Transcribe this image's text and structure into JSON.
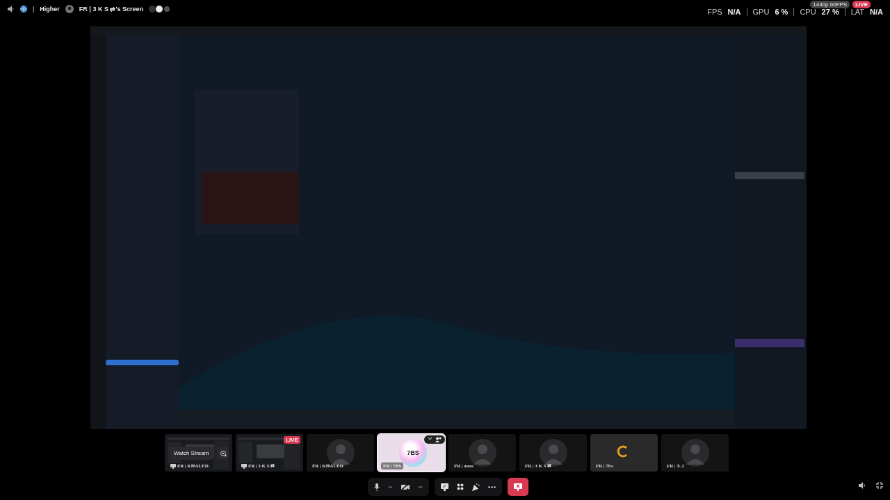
{
  "header": {
    "server": "Higher",
    "separator": "|",
    "stream_title": "FR | 3 K S ⇄'s Screen"
  },
  "stats": [
    {
      "label": "FPS",
      "value": "N/A"
    },
    {
      "label": "GPU",
      "value": "6 %"
    },
    {
      "label": "CPU",
      "value": "27 %"
    },
    {
      "label": "LAT",
      "value": "N/A"
    }
  ],
  "stream_badge": {
    "quality": "1440p 60FPS",
    "live": "LIVE"
  },
  "tiles": [
    {
      "kind": "stream",
      "name": "FR | KĦALED",
      "action": "Watch Stream",
      "selected": false
    },
    {
      "kind": "stream",
      "name": "FR | 3 K S ⇄",
      "live": "LIVE",
      "selected": false
    },
    {
      "kind": "avatar",
      "name": "FR | KĦALED",
      "selected": false
    },
    {
      "kind": "orb",
      "name": "FR | 7BS",
      "text": "7BS",
      "selected": true
    },
    {
      "kind": "avatar",
      "name": "FR | anas",
      "selected": false
    },
    {
      "kind": "avatar",
      "name": "FR | 3 K S ⇄",
      "selected": false
    },
    {
      "kind": "logo",
      "name": "FR | 7fw",
      "selected": false
    },
    {
      "kind": "avatar",
      "name": "FR | X.2",
      "selected": false
    }
  ]
}
